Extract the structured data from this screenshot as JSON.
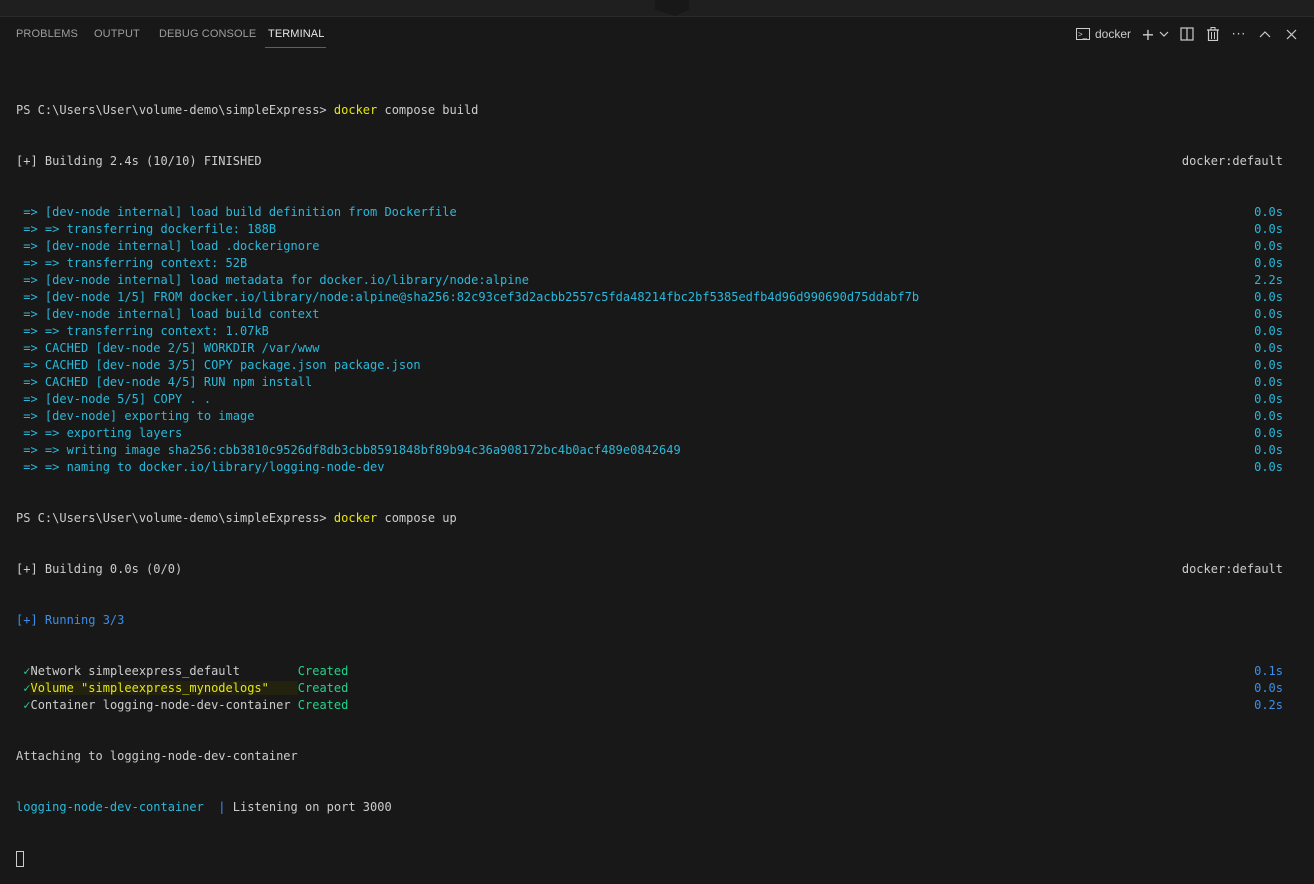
{
  "panel": {
    "tabs": [
      {
        "label": "PROBLEMS",
        "active": false
      },
      {
        "label": "OUTPUT",
        "active": false
      },
      {
        "label": "DEBUG CONSOLE",
        "active": false
      },
      {
        "label": "TERMINAL",
        "active": true
      }
    ],
    "actions": {
      "terminal_name": "docker",
      "terminal_icon": "terminal-icon",
      "new_terminal_icon": "plus-icon",
      "dropdown_icon": "chevron-down-icon",
      "split_icon": "split-icon",
      "kill_icon": "trash-icon",
      "more_icon": "ellipsis-icon",
      "maximize_icon": "chevron-up-icon",
      "close_icon": "close-icon"
    },
    "accent": "#0078d4"
  },
  "terminal": {
    "prompt1": {
      "ps": "PS C:\\Users\\User\\volume-demo\\simpleExpress> ",
      "cmd": "docker",
      "args": " compose build"
    },
    "build1": {
      "text": "[+] Building 2.4s (10/10) FINISHED",
      "right": "docker:default"
    },
    "steps": [
      {
        "text": " => [dev-node internal] load build definition from Dockerfile",
        "time": "0.0s"
      },
      {
        "text": " => => transferring dockerfile: 188B",
        "time": "0.0s"
      },
      {
        "text": " => [dev-node internal] load .dockerignore",
        "time": "0.0s"
      },
      {
        "text": " => => transferring context: 52B",
        "time": "0.0s"
      },
      {
        "text": " => [dev-node internal] load metadata for docker.io/library/node:alpine",
        "time": "2.2s"
      },
      {
        "text": " => [dev-node 1/5] FROM docker.io/library/node:alpine@sha256:82c93cef3d2acbb2557c5fda48214fbc2bf5385edfb4d96d990690d75ddabf7b",
        "time": "0.0s"
      },
      {
        "text": " => [dev-node internal] load build context",
        "time": "0.0s"
      },
      {
        "text": " => => transferring context: 1.07kB",
        "time": "0.0s"
      },
      {
        "text": " => CACHED [dev-node 2/5] WORKDIR /var/www",
        "time": "0.0s"
      },
      {
        "text": " => CACHED [dev-node 3/5] COPY package.json package.json",
        "time": "0.0s"
      },
      {
        "text": " => CACHED [dev-node 4/5] RUN npm install",
        "time": "0.0s"
      },
      {
        "text": " => [dev-node 5/5] COPY . .",
        "time": "0.0s"
      },
      {
        "text": " => [dev-node] exporting to image",
        "time": "0.0s"
      },
      {
        "text": " => => exporting layers",
        "time": "0.0s"
      },
      {
        "text": " => => writing image sha256:cbb3810c9526df8db3cbb8591848bf89b94c36a908172bc4b0acf489e0842649",
        "time": "0.0s"
      },
      {
        "text": " => => naming to docker.io/library/logging-node-dev",
        "time": "0.0s"
      }
    ],
    "prompt2": {
      "ps": "PS C:\\Users\\User\\volume-demo\\simpleExpress> ",
      "cmd": "docker",
      "args": " compose up"
    },
    "build2": {
      "text": "[+] Building 0.0s (0/0)",
      "right": "docker:default"
    },
    "running": "[+] Running 3/3",
    "resources": [
      {
        "check": "✓",
        "name": "Network simpleexpress_default        ",
        "status": "Created",
        "time": "0.1s",
        "highlight": false
      },
      {
        "check": "✓",
        "name": "Volume \"simpleexpress_mynodelogs\"    ",
        "status": "Created",
        "time": "0.0s",
        "highlight": true
      },
      {
        "check": "✓",
        "name": "Container logging-node-dev-container ",
        "status": "Created",
        "time": "0.2s",
        "highlight": false
      }
    ],
    "attaching": "Attaching to logging-node-dev-container",
    "log": {
      "container": "logging-node-dev-container",
      "sep": "  | ",
      "message": "Listening on port 3000"
    }
  }
}
